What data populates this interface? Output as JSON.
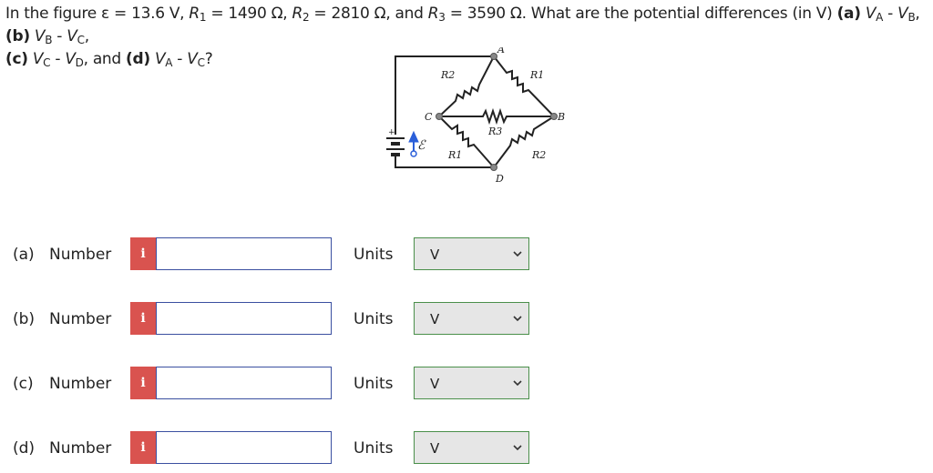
{
  "question": {
    "lead": "In the figure ε = 13.6 V, ",
    "r1_sym": "R",
    "r1_sub": "1",
    "r1_val": " = 1490 Ω, ",
    "r2_sym": "R",
    "r2_sub": "2",
    "r2_val": " = 2810 Ω, and ",
    "r3_sym": "R",
    "r3_sub": "3",
    "r3_val": " = 3590 Ω. What are the potential differences (in V) ",
    "a_tag": "(a)",
    "a_v1": "V",
    "a_s1": "A",
    "a_minus": " - ",
    "a_v2": "V",
    "a_s2": "B",
    "a_sep": ", ",
    "b_tag": "(b)",
    "b_v1": "V",
    "b_s1": "B",
    "b_minus": " - ",
    "b_v2": "V",
    "b_s2": "C",
    "b_sep": ",",
    "c_tag": "(c)",
    "c_v1": "V",
    "c_s1": "C",
    "c_minus": " - ",
    "c_v2": "V",
    "c_s2": "D",
    "c_sep": ", and ",
    "d_tag": "(d)",
    "d_v1": "V",
    "d_s1": "A",
    "d_minus": " - ",
    "d_v2": "V",
    "d_s2": "C",
    "d_end": "?"
  },
  "figure": {
    "node_a": "A",
    "node_b": "B",
    "node_c": "C",
    "node_d": "D",
    "label_r2_top": "R2",
    "label_r1_top": "R1",
    "label_r3": "R3",
    "label_r1_bottom": "R1",
    "label_r2_bottom": "R2",
    "emf_symbol": "ℰ",
    "plus_sign": "+"
  },
  "rows": [
    {
      "part": "(a)",
      "number_label": "Number",
      "info_icon": "i",
      "value": "",
      "units_label": "Units",
      "unit": "V"
    },
    {
      "part": "(b)",
      "number_label": "Number",
      "info_icon": "i",
      "value": "",
      "units_label": "Units",
      "unit": "V"
    },
    {
      "part": "(c)",
      "number_label": "Number",
      "info_icon": "i",
      "value": "",
      "units_label": "Units",
      "unit": "V"
    },
    {
      "part": "(d)",
      "number_label": "Number",
      "info_icon": "i",
      "value": "",
      "units_label": "Units",
      "unit": "V"
    }
  ],
  "colors": {
    "info_bg": "#d9534f",
    "input_border": "#3a4fa0",
    "select_border": "#4a8f4a",
    "select_bg": "#e6e6e6",
    "cursor_blue": "#2b5fd9"
  }
}
